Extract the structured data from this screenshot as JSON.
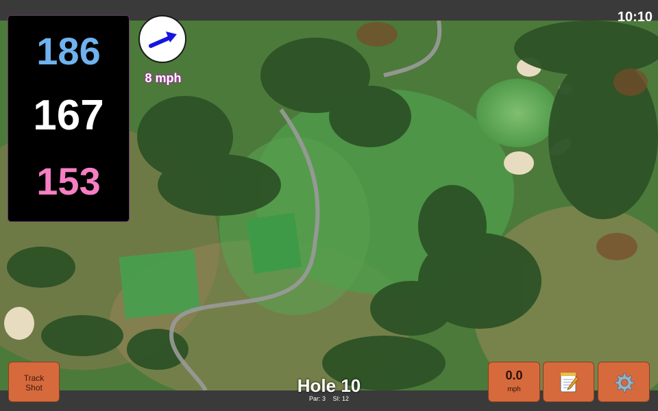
{
  "status": {
    "time": "10:10"
  },
  "yardage": {
    "back": "186",
    "middle": "167",
    "front": "153"
  },
  "wind": {
    "speed": "8 mph",
    "direction_icon": "wind-arrow-icon"
  },
  "hole": {
    "title": "Hole 10",
    "par": "Par: 3",
    "si": "SI: 12"
  },
  "buttons": {
    "track_line1": "Track",
    "track_line2": "Shot",
    "speed_value": "0.0",
    "speed_unit": "mph",
    "notes_icon": "notepad-icon",
    "settings_icon": "gear-icon"
  },
  "colors": {
    "back_yardage": "#6fb2ee",
    "middle_yardage": "#ffffff",
    "front_yardage": "#f47fc2",
    "button": "#d66a3c"
  }
}
